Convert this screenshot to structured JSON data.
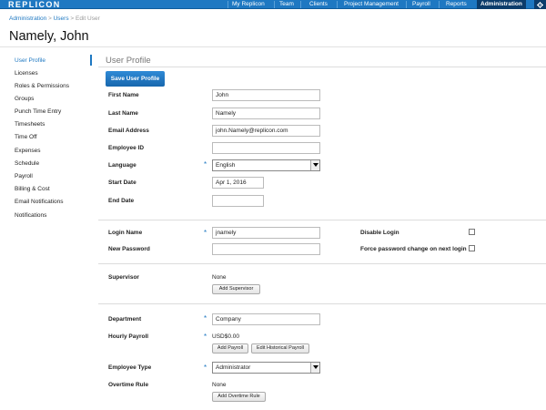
{
  "app": {
    "logo": "REPLICON",
    "nav": [
      {
        "label": "My Replicon"
      },
      {
        "label": "Team"
      },
      {
        "label": "Clients"
      },
      {
        "label": "Project Management"
      },
      {
        "label": "Payroll"
      },
      {
        "label": "Reports"
      },
      {
        "label": "Administration",
        "active": true
      }
    ],
    "settings_icon": "gear-icon",
    "accent_color": "#1e78c2"
  },
  "breadcrumb": {
    "items": [
      "Administration",
      "Users"
    ],
    "separator": ">",
    "current": "Edit User"
  },
  "page_title": "Namely, John",
  "sidebar": {
    "items": [
      {
        "label": "User Profile",
        "active": true
      },
      {
        "label": "Licenses"
      },
      {
        "label": "Roles & Permissions"
      },
      {
        "label": "Groups"
      },
      {
        "label": "Punch Time Entry"
      },
      {
        "label": "Timesheets"
      },
      {
        "label": "Time Off"
      },
      {
        "label": "Expenses"
      },
      {
        "label": "Schedule"
      },
      {
        "label": "Payroll"
      },
      {
        "label": "Billing & Cost"
      },
      {
        "label": "Email Notifications"
      },
      {
        "label": "Notifications"
      }
    ]
  },
  "profile": {
    "title": "User Profile",
    "save_label": "Save User Profile",
    "first_name": {
      "label": "First Name",
      "value": "John"
    },
    "last_name": {
      "label": "Last Name",
      "value": "Namely"
    },
    "email": {
      "label": "Email Address",
      "value": "john.Namely@replicon.com"
    },
    "employee_id": {
      "label": "Employee ID",
      "value": ""
    },
    "language": {
      "label": "Language",
      "value": "English",
      "required": true
    },
    "start_date": {
      "label": "Start Date",
      "value": "Apr 1, 2016"
    },
    "end_date": {
      "label": "End Date",
      "value": ""
    },
    "login_name": {
      "label": "Login Name",
      "value": "jnamely",
      "required": true
    },
    "new_password": {
      "label": "New Password",
      "value": ""
    },
    "disable_login": {
      "label": "Disable Login",
      "checked": false
    },
    "force_password_change": {
      "label": "Force password change on next login",
      "checked": false
    },
    "supervisor": {
      "label": "Supervisor",
      "value": "None",
      "button": "Add Supervisor"
    },
    "department": {
      "label": "Department",
      "value": "Company",
      "required": true
    },
    "hourly_payroll": {
      "label": "Hourly Payroll",
      "value": "USD$0.00",
      "required": true,
      "add_button": "Add Payroll",
      "history_button": "Edit Historical Payroll"
    },
    "employee_type": {
      "label": "Employee Type",
      "value": "Administrator",
      "required": true
    },
    "overtime_rule": {
      "label": "Overtime Rule",
      "value": "None",
      "button": "Add Overtime Rule"
    },
    "required_marker": "*"
  }
}
